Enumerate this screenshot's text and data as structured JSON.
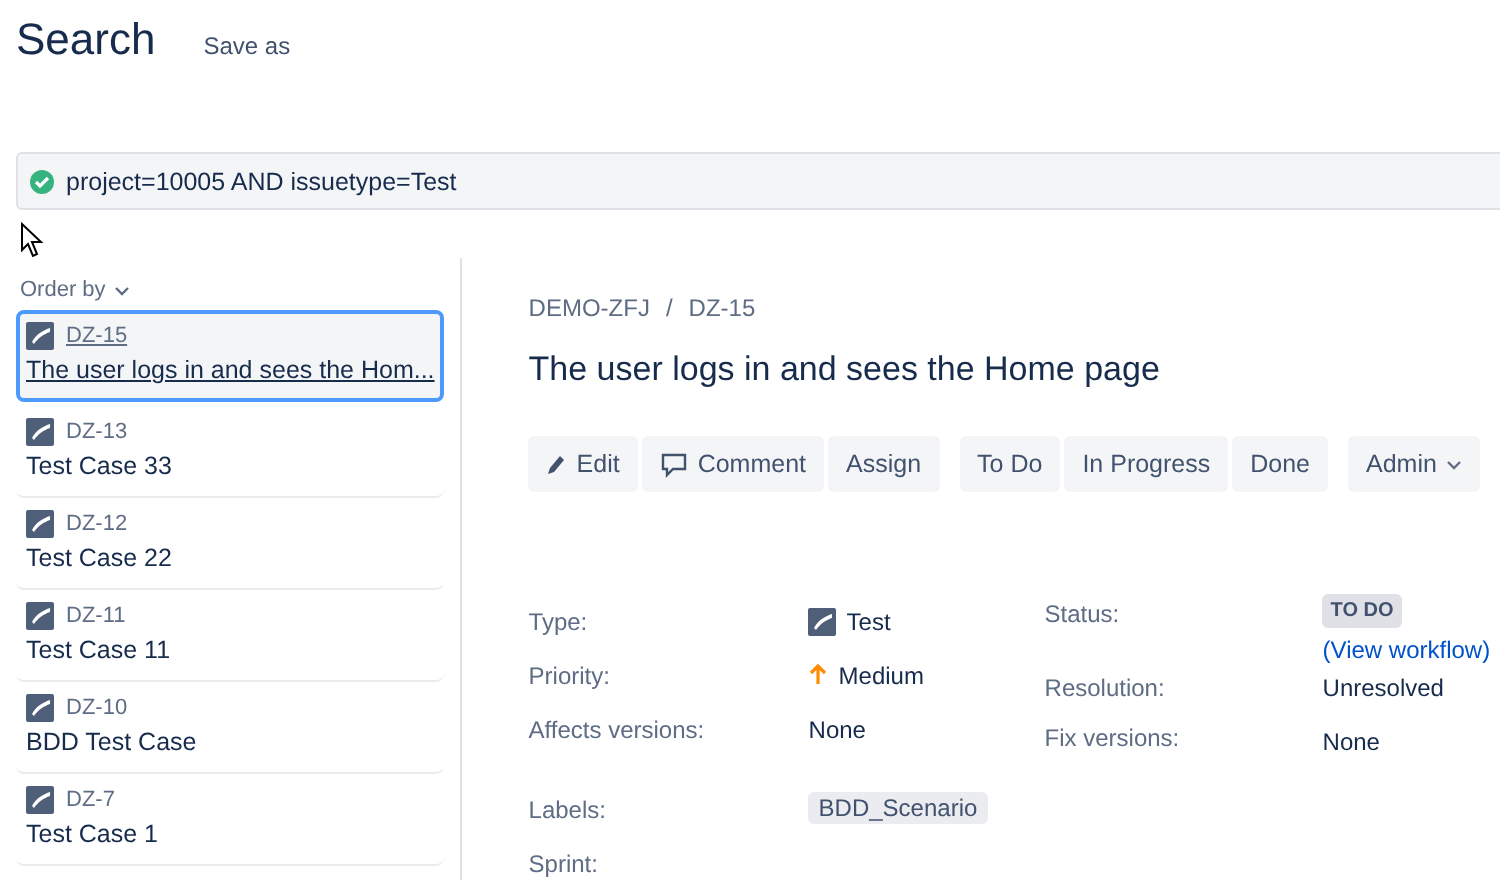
{
  "header": {
    "title": "Search",
    "save_as": "Save as"
  },
  "query": {
    "valid": true,
    "text": "project=10005 AND issuetype=Test"
  },
  "order_by": "Order by",
  "issues": [
    {
      "key": "DZ-15",
      "summary": "The user logs in and sees the Hom...",
      "selected": true
    },
    {
      "key": "DZ-13",
      "summary": "Test Case 33",
      "selected": false
    },
    {
      "key": "DZ-12",
      "summary": "Test Case 22",
      "selected": false
    },
    {
      "key": "DZ-11",
      "summary": "Test Case 11",
      "selected": false
    },
    {
      "key": "DZ-10",
      "summary": "BDD Test Case",
      "selected": false
    },
    {
      "key": "DZ-7",
      "summary": "Test Case 1",
      "selected": false
    }
  ],
  "detail": {
    "breadcrumb": [
      "DEMO-ZFJ",
      "DZ-15"
    ],
    "breadcrumb_separator": "/",
    "title": "The user logs in and sees the Home page",
    "toolbar": [
      [
        {
          "kind": "edit",
          "label": "Edit"
        },
        {
          "kind": "comment",
          "label": "Comment"
        },
        {
          "kind": "plain",
          "label": "Assign"
        }
      ],
      [
        {
          "kind": "plain",
          "label": "To Do"
        },
        {
          "kind": "plain",
          "label": "In Progress"
        },
        {
          "kind": "plain",
          "label": "Done"
        }
      ],
      [
        {
          "kind": "dropdown",
          "label": "Admin"
        }
      ]
    ],
    "left_fields": [
      {
        "label": "Type:",
        "kind": "type",
        "value": "Test"
      },
      {
        "label": "Priority:",
        "kind": "priority",
        "value": "Medium"
      },
      {
        "label": "Affects versions:",
        "kind": "text",
        "value": "None"
      },
      {
        "label": "Labels:",
        "kind": "label",
        "value": "BDD_Scenario"
      },
      {
        "label": "Sprint:",
        "kind": "empty"
      }
    ],
    "status": {
      "label": "Status:",
      "value": "TO DO",
      "link": "(View workflow)"
    },
    "right_fields": [
      {
        "label": "Resolution:",
        "value": "Unresolved"
      },
      {
        "label": "Fix versions:",
        "value": "None"
      }
    ]
  }
}
